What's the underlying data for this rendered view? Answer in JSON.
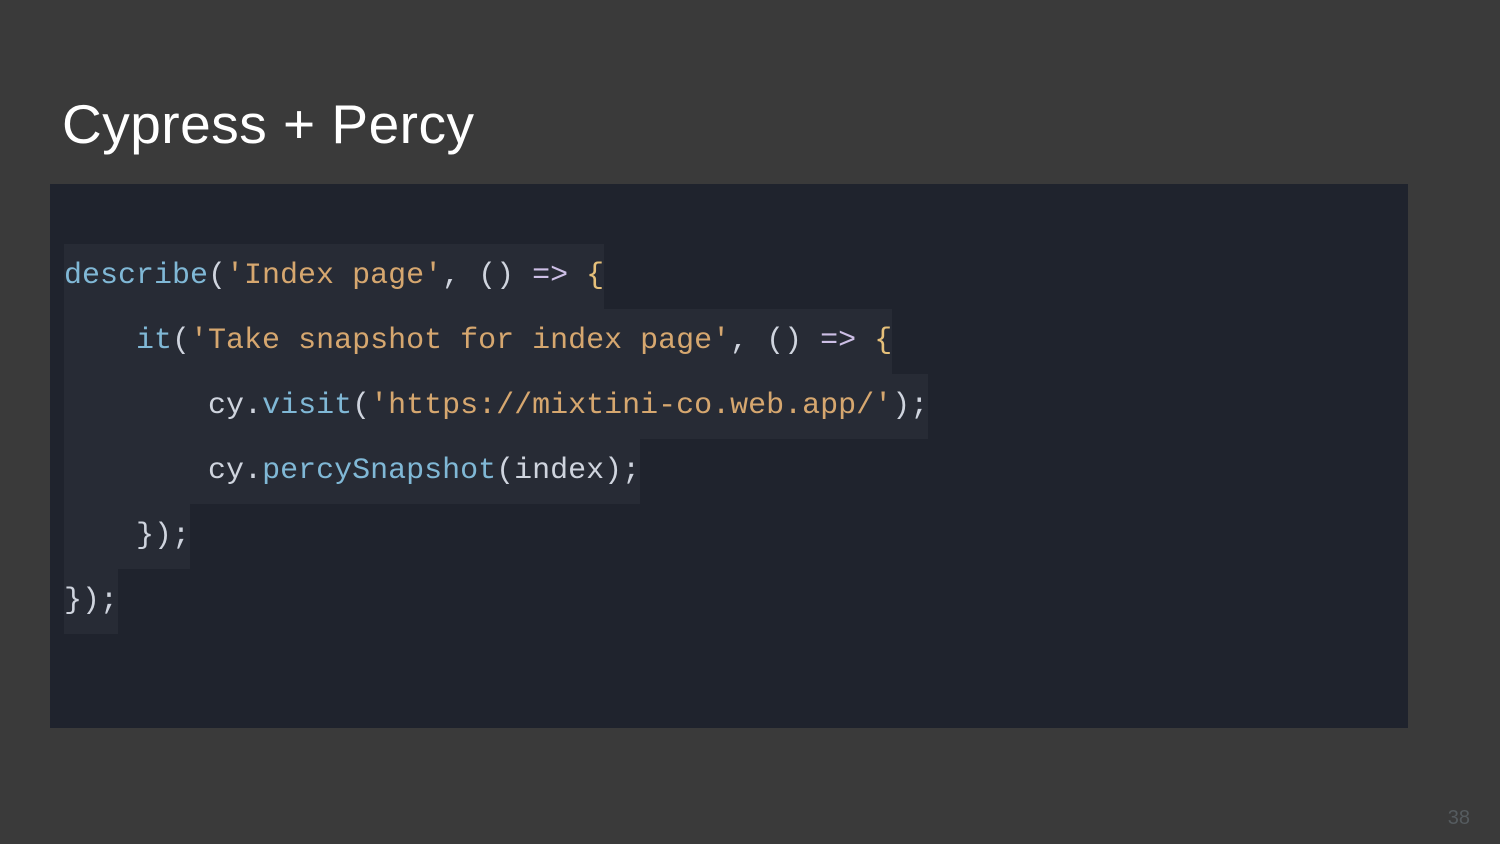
{
  "slide": {
    "title": "Cypress + Percy",
    "page_number": "38"
  },
  "code": {
    "line1": {
      "fn": "describe",
      "open": "(",
      "str": "'Index page'",
      "mid": ", () ",
      "arrow": "=>",
      "space": " ",
      "brace": "{"
    },
    "line2": {
      "indent": "    ",
      "fn": "it",
      "open": "(",
      "str": "'Take snapshot for index page'",
      "mid": ", () ",
      "arrow": "=>",
      "space": " ",
      "brace": "{"
    },
    "line3": {
      "indent": "        ",
      "obj": "cy",
      "dot1": ".",
      "fn": "visit",
      "open": "(",
      "str": "'https://mixtini-co.web.app/'",
      "close": ");"
    },
    "line4": {
      "indent": "        ",
      "obj": "cy",
      "dot1": ".",
      "fn": "percySnapshot",
      "open": "(",
      "arg": "index",
      "close": ");"
    },
    "line5": {
      "indent": "    ",
      "text": "});"
    },
    "line6": {
      "text": "});"
    }
  }
}
